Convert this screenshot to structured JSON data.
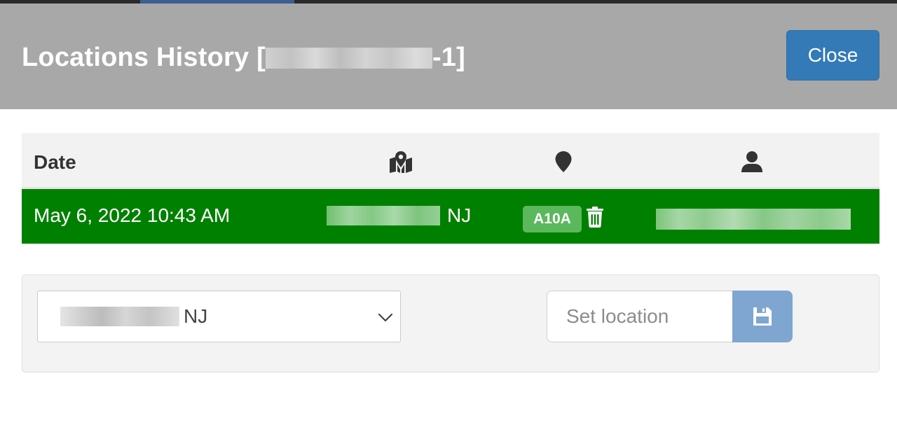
{
  "modal": {
    "title_prefix": "Locations History [",
    "title_suffix": "-1]",
    "close_label": "Close"
  },
  "table": {
    "headers": {
      "date": "Date",
      "map_icon": "map-marked-icon",
      "marker_icon": "map-marker-icon",
      "user_icon": "user-icon"
    },
    "rows": [
      {
        "date": "May 6, 2022 10:43 AM",
        "location_state": "NJ",
        "code": "A10A",
        "delete_icon": "trash-icon"
      }
    ]
  },
  "form": {
    "selected_location_state": "NJ",
    "location_placeholder": "Set location",
    "location_value": "",
    "save_icon": "floppy-disk-icon"
  },
  "colors": {
    "header_bg": "#a8a8a8",
    "primary": "#337ab7",
    "row_success": "#008000",
    "badge": "#5cb85c",
    "save_button": "#7ea6d0"
  }
}
